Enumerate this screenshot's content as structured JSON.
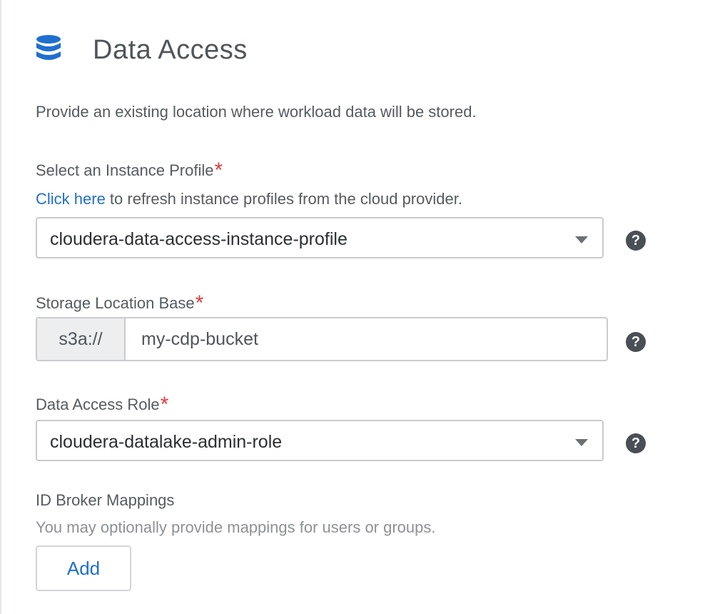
{
  "header": {
    "title": "Data Access",
    "icon": "database-icon",
    "icon_color": "#1f6fd1"
  },
  "description": "Provide an existing location where workload data will be stored.",
  "instance_profile": {
    "label": "Select an Instance Profile",
    "required_mark": "*",
    "refresh_link": "Click here",
    "refresh_text": " to refresh instance profiles from the cloud provider.",
    "selected": "cloudera-data-access-instance-profile"
  },
  "storage_location": {
    "label": "Storage Location Base",
    "required_mark": "*",
    "prefix": "s3a://",
    "value": "my-cdp-bucket"
  },
  "data_access_role": {
    "label": "Data Access Role",
    "required_mark": "*",
    "selected": "cloudera-datalake-admin-role"
  },
  "id_broker": {
    "label": "ID Broker Mappings",
    "hint": "You may optionally provide mappings for users or groups.",
    "add_label": "Add"
  },
  "help_icon_text": "?"
}
